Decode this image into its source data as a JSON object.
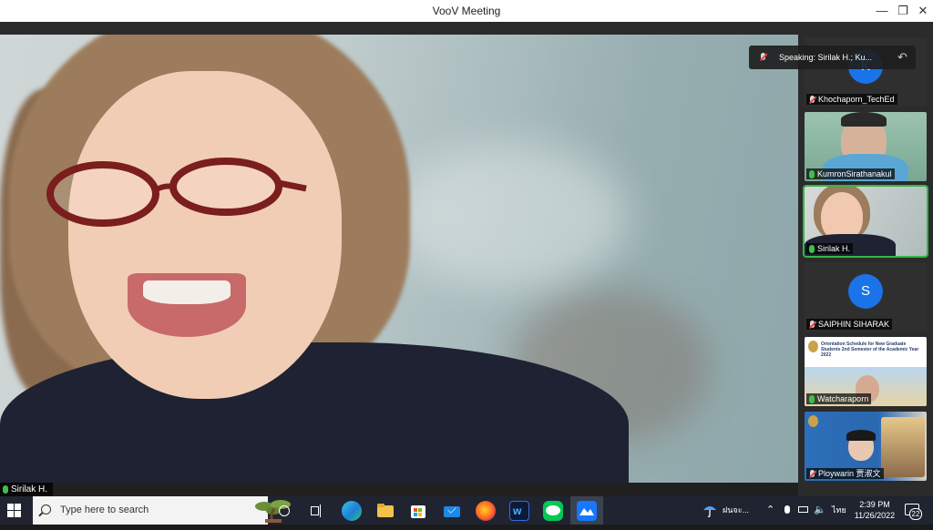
{
  "window": {
    "title": "VooV Meeting",
    "min_icon": "minimize-icon",
    "max_icon": "restore-icon",
    "close_icon": "close-icon",
    "min_glyph": "—",
    "max_glyph": "❐",
    "close_glyph": "✕"
  },
  "main_video": {
    "speaker_name": "Sirilak H.",
    "mic_state": "unmuted"
  },
  "speaking_toast": {
    "text": "Speaking: Sirilak H.; Ku..."
  },
  "participants": [
    {
      "name": "Khochaporn_TechEd",
      "mic": "muted",
      "video": "avatar",
      "avatar_letter": "K"
    },
    {
      "name": "KumronSirathanakul",
      "mic": "unmuted",
      "video": "camera"
    },
    {
      "name": "Sirilak H.",
      "mic": "unmuted",
      "video": "camera",
      "active": true
    },
    {
      "name": "SAIPHIN SIHARAK",
      "mic": "muted",
      "video": "avatar",
      "avatar_letter": "S"
    },
    {
      "name": "Watcharaporn",
      "mic": "unmuted",
      "video": "shared-slide",
      "slide_text": "Orientation Schedule for New Graduate Students 2nd Semester of the Academic Year 2022"
    },
    {
      "name": "Ploywarin 贾淑文",
      "mic": "muted",
      "video": "camera"
    }
  ],
  "taskbar": {
    "search_placeholder": "Type here to search",
    "weather_text": "ฝนจะ...",
    "language": "ไทย",
    "time": "2:39 PM",
    "date": "11/26/2022",
    "notification_count": "22"
  },
  "colors": {
    "active_speaker": "#35b44a",
    "avatar_blue": "#1a73e8",
    "muted_red": "#e84040"
  }
}
